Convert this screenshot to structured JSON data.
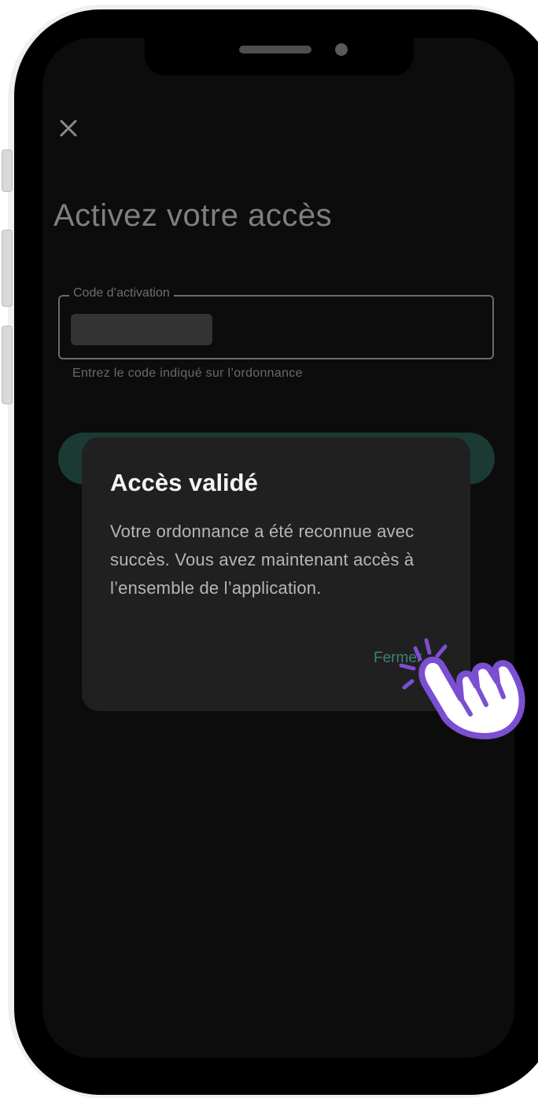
{
  "screen": {
    "title": "Activez votre accès",
    "close_icon": "close-icon",
    "activation_field": {
      "label": "Code d’activation",
      "value_redacted": true,
      "helper": "Entrez le code indiqué sur l’ordonnance"
    }
  },
  "dialog": {
    "title": "Accès validé",
    "body": "Votre ordonnance a été reconnue avec succès. Vous avez maintenant accès à l’ensemble de l’application.",
    "action_label": "Fermer"
  },
  "colors": {
    "accent": "#3f8279",
    "pointer": "#7b4fd1"
  },
  "icons": [
    "close-icon",
    "tap-hand-icon"
  ]
}
